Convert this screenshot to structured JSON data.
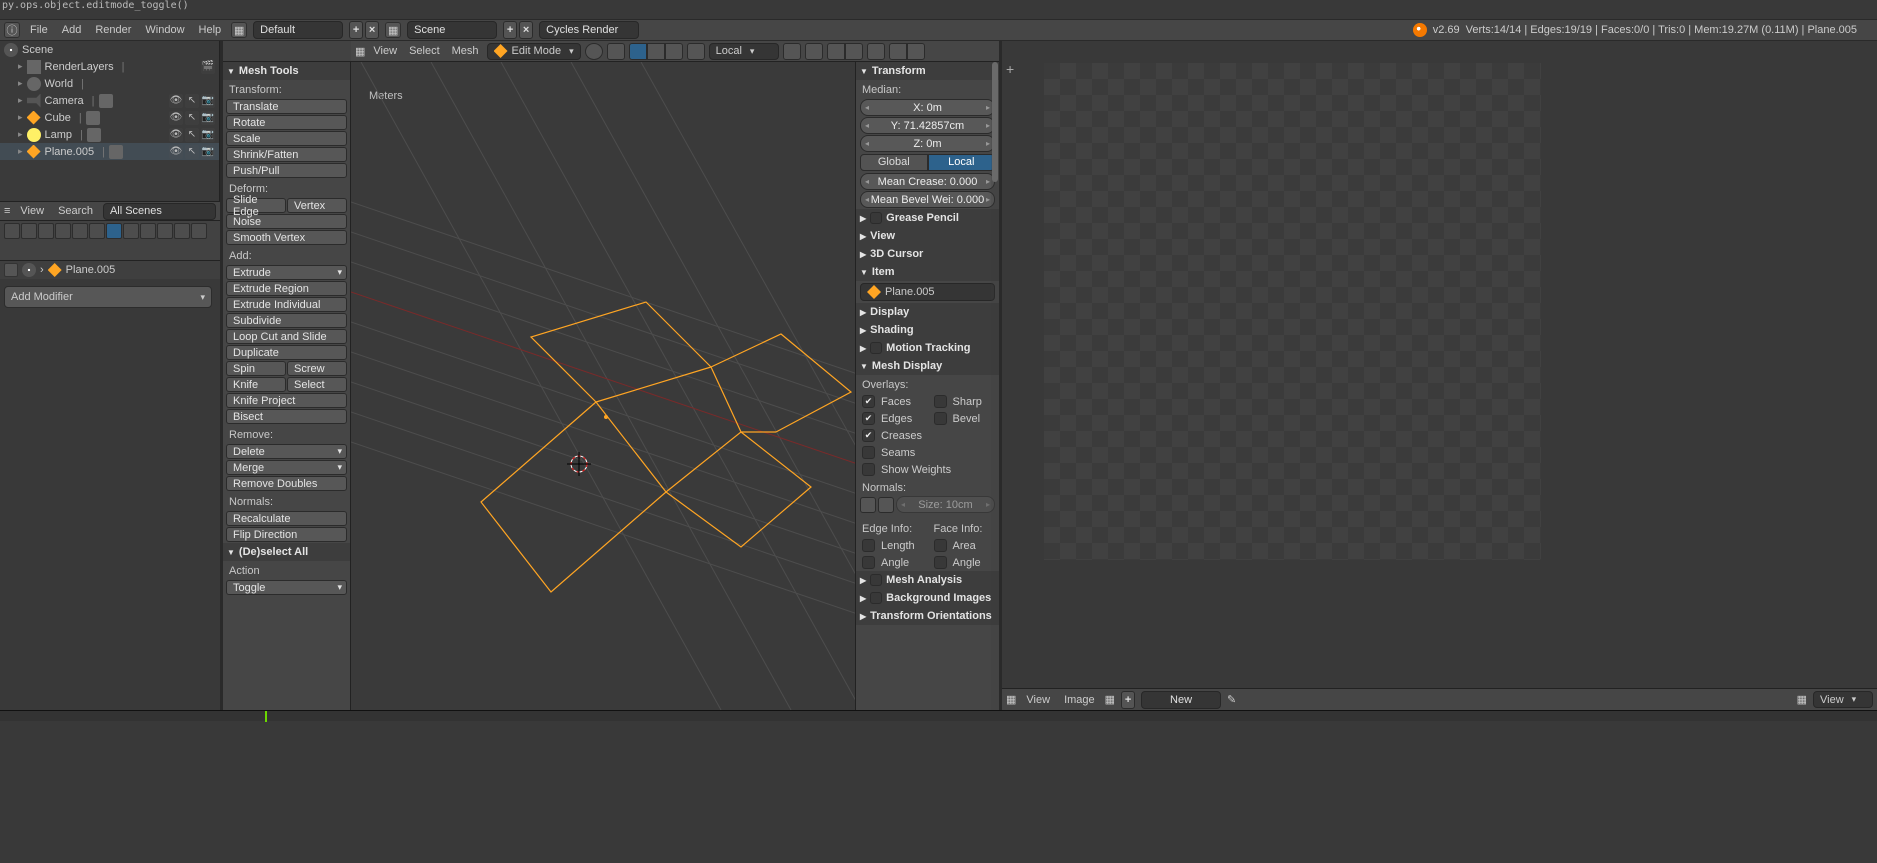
{
  "python_last_op": "py.ops.object.editmode_toggle()",
  "info_header": {
    "menus": [
      "File",
      "Add",
      "Render",
      "Window",
      "Help"
    ],
    "screen_layout": "Default",
    "scene": "Scene",
    "render_engine": "Cycles Render",
    "version": "v2.69",
    "stats": "Verts:14/14 | Edges:19/19 | Faces:0/0 | Tris:0 | Mem:19.27M (0.11M) | Plane.005"
  },
  "outliner": {
    "root": "Scene",
    "nodes": [
      {
        "label": "RenderLayers",
        "icon": "layers",
        "toggles": [
          "clip"
        ]
      },
      {
        "label": "World",
        "icon": "world"
      },
      {
        "label": "Camera",
        "icon": "cam",
        "toggles": [
          "eye",
          "cursor",
          "camera"
        ],
        "child": "camdata"
      },
      {
        "label": "Cube",
        "icon": "mesh",
        "toggles": [
          "eye",
          "cursor",
          "camera"
        ],
        "child": "meshdata"
      },
      {
        "label": "Lamp",
        "icon": "lamp",
        "toggles": [
          "eye",
          "cursor",
          "camera"
        ],
        "child": "lampdata"
      },
      {
        "label": "Plane.005",
        "icon": "mesh",
        "toggles": [
          "eye",
          "cursor",
          "camera"
        ],
        "child": "meshdata",
        "selected": true
      }
    ],
    "header": {
      "menus": [
        "View",
        "Search"
      ],
      "filter": "All Scenes"
    }
  },
  "properties": {
    "breadcrumb_obj": "Plane.005",
    "add_modifier": "Add Modifier"
  },
  "toolshelf": {
    "title": "Mesh Tools",
    "sections": {
      "Transform:": [
        "Translate",
        "Rotate",
        "Scale",
        "Shrink/Fatten",
        "Push/Pull"
      ],
      "Deform:": [
        [
          "Slide Edge",
          "Vertex"
        ],
        "Noise",
        "Smooth Vertex"
      ],
      "Add:": [
        "Extrude",
        "Extrude Region",
        "Extrude Individual",
        "Subdivide",
        "Loop Cut and Slide",
        "Duplicate",
        [
          "Spin",
          "Screw"
        ],
        [
          "Knife",
          "Select"
        ],
        "Knife Project",
        "Bisect"
      ],
      "Remove:": [
        "Delete",
        "Merge",
        "Remove Doubles"
      ],
      "Normals:": [
        "Recalculate",
        "Flip Direction"
      ]
    },
    "dropdown_items": [
      "Extrude",
      "Delete",
      "Merge"
    ],
    "deselect_panel": {
      "title": "(De)select All",
      "Action": "Action",
      "value": "Toggle"
    }
  },
  "view3d_header": {
    "menus": [
      "View",
      "Select",
      "Mesh"
    ],
    "mode": "Edit Mode",
    "orient": "Local",
    "overlay_label": "Meters"
  },
  "npanel": {
    "transform_title": "Transform",
    "median_label": "Median:",
    "x": "X: 0m",
    "y": "Y: 71.42857cm",
    "z": "Z: 0m",
    "space": [
      "Global",
      "Local"
    ],
    "space_sel": "Local",
    "mean_crease": "Mean Crease: 0.000",
    "mean_bevel": "Mean Bevel Wei: 0.000",
    "closed_panels": [
      "Grease Pencil",
      "View",
      "3D Cursor"
    ],
    "item_title": "Item",
    "item_name": "Plane.005",
    "closed_panels2": [
      "Display",
      "Shading",
      "Motion Tracking"
    ],
    "meshdisplay_title": "Mesh Display",
    "overlays_label": "Overlays:",
    "overlay_checks": [
      {
        "l": "Faces",
        "lon": true,
        "r": "Sharp",
        "ron": false
      },
      {
        "l": "Edges",
        "lon": true,
        "r": "Bevel",
        "ron": false
      },
      {
        "l": "Creases",
        "lon": true
      },
      {
        "l": "Seams",
        "lon": false
      },
      {
        "l": "Show Weights",
        "lon": false
      }
    ],
    "normals_label": "Normals:",
    "normals_size": "Size: 10cm",
    "edge_info": "Edge Info:",
    "face_info": "Face Info:",
    "info_checks": [
      {
        "l": "Length",
        "r": "Area"
      },
      {
        "l": "Angle",
        "r": "Angle"
      }
    ],
    "closed_panels3": [
      "Mesh Analysis",
      "Background Images",
      "Transform Orientations"
    ]
  },
  "image_editor": {
    "menus": [
      "View",
      "Image"
    ],
    "new": "New",
    "view2": "View"
  }
}
